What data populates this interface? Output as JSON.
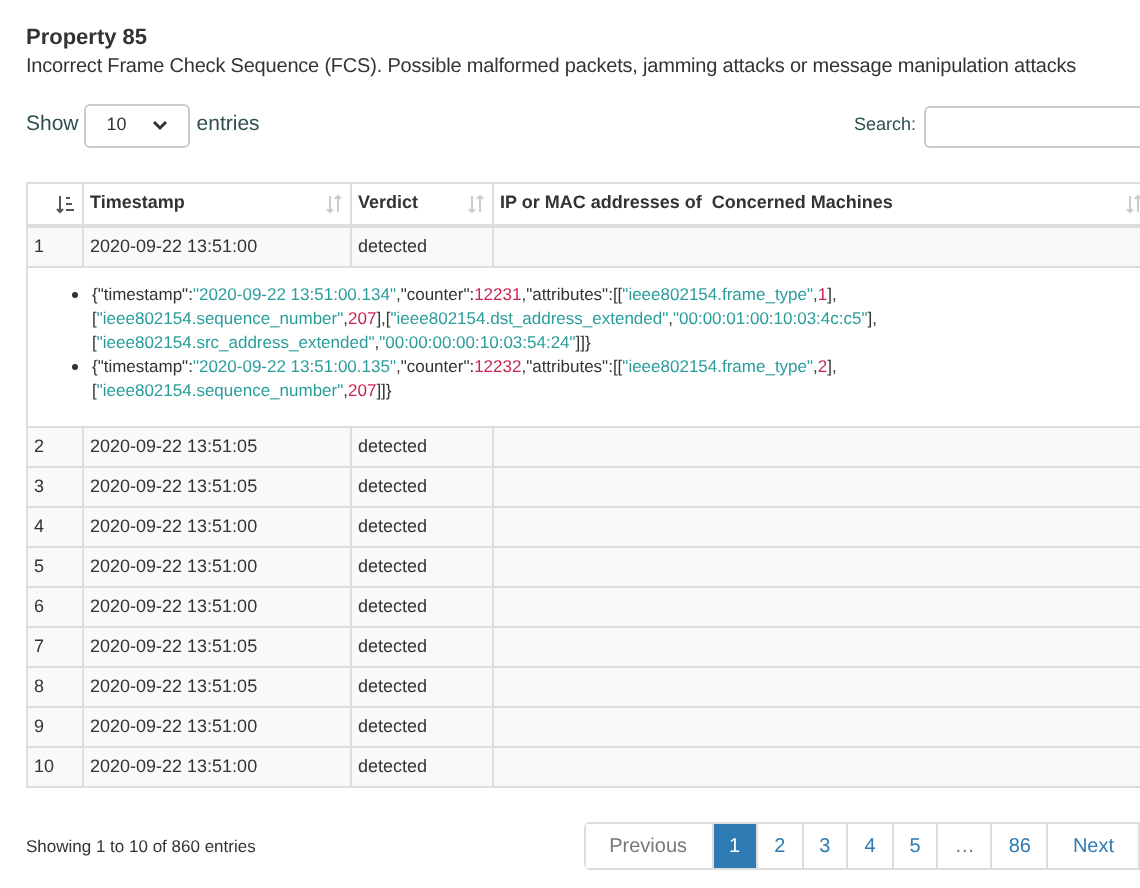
{
  "title": "Property 85",
  "description": "Incorrect Frame Check Sequence (FCS). Possible malformed packets, jamming attacks or message manipulation attacks",
  "length_menu": {
    "prefix": "Show",
    "value": "10",
    "suffix": "entries"
  },
  "search": {
    "label": "Search:"
  },
  "table": {
    "columns": [
      {
        "sorted": true
      },
      {
        "label": "Timestamp",
        "sorted": false
      },
      {
        "label": "Verdict",
        "sorted": false
      },
      {
        "label": "IP or MAC addresses of  Concerned Machines",
        "sorted": false
      }
    ],
    "rows": [
      {
        "cells": [
          "1",
          "2020-09-22 13:51:00",
          "detected"
        ],
        "details": [
          {
            "lines": [
              [
                {
                  "kind": "p",
                  "t": "{\"timestamp\":"
                },
                {
                  "kind": "s",
                  "t": "\"2020-09-22 13:51:00.134\""
                },
                {
                  "kind": "p",
                  "t": ",\"counter\":"
                },
                {
                  "kind": "n",
                  "t": "12231"
                },
                {
                  "kind": "p",
                  "t": ",\"attributes\":[["
                },
                {
                  "kind": "s",
                  "t": "\"ieee802154.frame_type\""
                },
                {
                  "kind": "p",
                  "t": ","
                },
                {
                  "kind": "n",
                  "t": "1"
                },
                {
                  "kind": "p",
                  "t": "],"
                }
              ],
              [
                {
                  "kind": "p",
                  "t": "["
                },
                {
                  "kind": "s",
                  "t": "\"ieee802154.sequence_number\""
                },
                {
                  "kind": "p",
                  "t": ","
                },
                {
                  "kind": "n",
                  "t": "207"
                },
                {
                  "kind": "p",
                  "t": "],["
                },
                {
                  "kind": "s",
                  "t": "\"ieee802154.dst_address_extended\""
                },
                {
                  "kind": "p",
                  "t": ","
                },
                {
                  "kind": "s",
                  "t": "\"00:00:01:00:10:03:4c:c5\""
                },
                {
                  "kind": "p",
                  "t": "],"
                }
              ],
              [
                {
                  "kind": "p",
                  "t": "["
                },
                {
                  "kind": "s",
                  "t": "\"ieee802154.src_address_extended\""
                },
                {
                  "kind": "p",
                  "t": ","
                },
                {
                  "kind": "s",
                  "t": "\"00:00:00:00:10:03:54:24\""
                },
                {
                  "kind": "p",
                  "t": "]]}"
                }
              ]
            ]
          },
          {
            "lines": [
              [
                {
                  "kind": "p",
                  "t": "{\"timestamp\":"
                },
                {
                  "kind": "s",
                  "t": "\"2020-09-22 13:51:00.135\""
                },
                {
                  "kind": "p",
                  "t": ",\"counter\":"
                },
                {
                  "kind": "n",
                  "t": "12232"
                },
                {
                  "kind": "p",
                  "t": ",\"attributes\":[["
                },
                {
                  "kind": "s",
                  "t": "\"ieee802154.frame_type\""
                },
                {
                  "kind": "p",
                  "t": ","
                },
                {
                  "kind": "n",
                  "t": "2"
                },
                {
                  "kind": "p",
                  "t": "],"
                }
              ],
              [
                {
                  "kind": "p",
                  "t": "["
                },
                {
                  "kind": "s",
                  "t": "\"ieee802154.sequence_number\""
                },
                {
                  "kind": "p",
                  "t": ","
                },
                {
                  "kind": "n",
                  "t": "207"
                },
                {
                  "kind": "p",
                  "t": "]]}"
                }
              ]
            ]
          }
        ]
      },
      {
        "cells": [
          "2",
          "2020-09-22 13:51:05",
          "detected"
        ]
      },
      {
        "cells": [
          "3",
          "2020-09-22 13:51:05",
          "detected"
        ]
      },
      {
        "cells": [
          "4",
          "2020-09-22 13:51:00",
          "detected"
        ]
      },
      {
        "cells": [
          "5",
          "2020-09-22 13:51:00",
          "detected"
        ]
      },
      {
        "cells": [
          "6",
          "2020-09-22 13:51:00",
          "detected"
        ]
      },
      {
        "cells": [
          "7",
          "2020-09-22 13:51:05",
          "detected"
        ]
      },
      {
        "cells": [
          "8",
          "2020-09-22 13:51:05",
          "detected"
        ]
      },
      {
        "cells": [
          "9",
          "2020-09-22 13:51:00",
          "detected"
        ]
      },
      {
        "cells": [
          "10",
          "2020-09-22 13:51:00",
          "detected"
        ]
      }
    ]
  },
  "info": "Showing 1 to 10 of 860 entries",
  "pagination": [
    {
      "label": "Previous",
      "kind": "nav",
      "disabled": true
    },
    {
      "label": "1",
      "kind": "page",
      "selected": true
    },
    {
      "label": "2",
      "kind": "page",
      "selected": false
    },
    {
      "label": "3",
      "kind": "page",
      "selected": false
    },
    {
      "label": "4",
      "kind": "page",
      "selected": false
    },
    {
      "label": "5",
      "kind": "page",
      "selected": false
    },
    {
      "label": "…",
      "kind": "ellipsis"
    },
    {
      "label": "86",
      "kind": "page",
      "selected": false
    },
    {
      "label": "Next",
      "kind": "nav",
      "disabled": false
    }
  ]
}
